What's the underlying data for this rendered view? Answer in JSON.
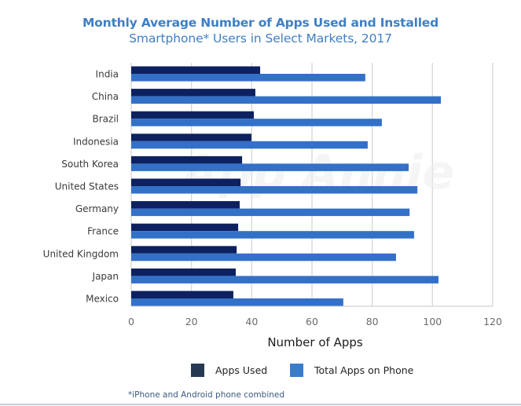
{
  "chart_data": {
    "type": "bar",
    "orientation": "horizontal",
    "title": "Monthly Average Number of Apps Used and Installed",
    "subtitle": "Smartphone* Users in Select Markets, 2017",
    "xlabel": "Number of Apps",
    "ylabel": "",
    "xlim": [
      0,
      120
    ],
    "xticks": [
      0,
      20,
      40,
      60,
      80,
      100,
      120
    ],
    "grid": true,
    "legend_position": "bottom",
    "categories": [
      "India",
      "China",
      "Brazil",
      "Indonesia",
      "South Korea",
      "United States",
      "Germany",
      "France",
      "United Kingdom",
      "Japan",
      "Mexico"
    ],
    "series": [
      {
        "name": "Apps Used",
        "color": "#0d2160",
        "legend_color": "#253a52",
        "values": [
          42.8,
          41.2,
          40.7,
          39.9,
          36.8,
          36.3,
          36.0,
          35.5,
          35.0,
          34.7,
          33.9
        ]
      },
      {
        "name": "Total Apps on Phone",
        "color": "#3370c8",
        "legend_color": "#3a7cc9",
        "values": [
          77.7,
          102.8,
          83.2,
          78.5,
          92.1,
          95.0,
          92.4,
          93.9,
          87.9,
          102.0,
          70.4
        ]
      }
    ],
    "watermark": "App Annie",
    "footnote": "*iPhone and Android phone combined"
  },
  "colors": {
    "title": "#3f7fc4",
    "gridline": "#d9d9d9"
  }
}
